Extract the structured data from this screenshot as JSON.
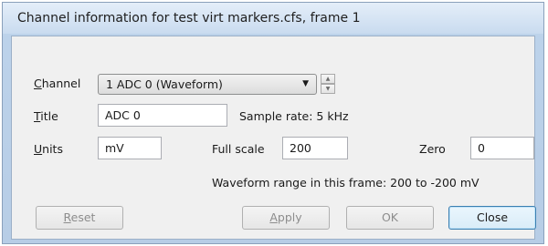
{
  "window": {
    "title": "Channel information for test virt markers.cfs, frame 1"
  },
  "channel": {
    "label_u": "C",
    "label_rest": "hannel",
    "selected": "1 ADC 0 (Waveform)"
  },
  "title_row": {
    "label_u": "T",
    "label_rest": "itle",
    "value": "ADC 0",
    "sample_rate": "Sample rate: 5 kHz"
  },
  "units_row": {
    "label_u": "U",
    "label_rest": "nits",
    "value": "mV",
    "full_scale_label": "Full scale",
    "full_scale_value": "200",
    "zero_label": "Zero",
    "zero_value": "0"
  },
  "range_text": "Waveform range in this frame: 200 to -200 mV",
  "buttons": {
    "reset_u": "R",
    "reset_rest": "eset",
    "apply_u": "A",
    "apply_rest": "pply",
    "ok": "OK",
    "close": "Close"
  },
  "icons": {
    "dropdown": "triangle-down",
    "spin_up": "triangle-up",
    "spin_down": "triangle-down"
  }
}
